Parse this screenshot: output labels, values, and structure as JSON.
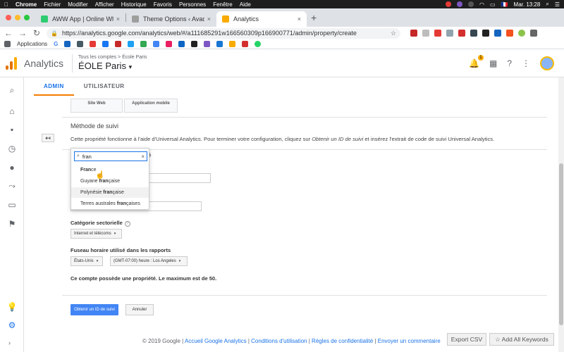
{
  "menubar": {
    "app": "Chrome",
    "items": [
      "Fichier",
      "Modifier",
      "Afficher",
      "Historique",
      "Favoris",
      "Personnes",
      "Fenêtre",
      "Aide"
    ],
    "flag": "🇫🇷",
    "clock": "Mar. 13:28"
  },
  "tabs": [
    {
      "title": "AWW App | Online Whiteboard",
      "close": "×",
      "color": "#2ecc71"
    },
    {
      "title": "Theme Options ‹ Avada Seo —",
      "close": "×",
      "color": "#9e9e9e"
    },
    {
      "title": "Analytics",
      "close": "×",
      "color": "#f9ab00"
    }
  ],
  "newtab_label": "+",
  "address": {
    "url": "https://analytics.google.com/analytics/web/#/a111685291w166560309p166900771/admin/property/create"
  },
  "bookmarks": {
    "apps_label": "Applications",
    "g_label": "G"
  },
  "ga": {
    "app_name": "Analytics",
    "breadcrumb": "Tous les comptes > École Paris",
    "property": "ÉOLE Paris",
    "property_caret": "▾",
    "notif_count": "1",
    "logo_colors": [
      "#f9ab00",
      "#e37400",
      "#e37400"
    ]
  },
  "admin_tabs": [
    "ADMIN",
    "UTILISATEUR"
  ],
  "form": {
    "segment_labels": [
      "Site Web",
      "Application mobile"
    ],
    "section_title": "Méthode de suivi",
    "desc_prefix": "Cette propriété fonctionne à l'aide d'Universal Analytics. Pour terminer votre configuration, cliquez sur ",
    "desc_link": "Obtenir un ID de suivi",
    "desc_suffix": " et insérez l'extrait de code de suivi Universal Analytics.",
    "partial_label": "é",
    "category_label": "Catégorie sectorielle",
    "category_help": "?",
    "category_value": "Internet et télécoms",
    "timezone_label": "Fuseau horaire utilisé dans les rapports",
    "country_value": "États-Unis",
    "timezone_value": "(GMT-07:00) heure : Los Angeles",
    "caret": "▾",
    "max_note": "Ce compte possède une propriété. Le maximum est de 50.",
    "primary_button": "Obtenir un ID de suivi",
    "cancel_button": "Annuler"
  },
  "dropdown": {
    "query": "fran",
    "clear": "×",
    "options": [
      {
        "before": "",
        "match": "Fran",
        "after": "ce"
      },
      {
        "before": "Guyane ",
        "match": "fran",
        "after": "çaise"
      },
      {
        "before": "Polynésie ",
        "match": "fran",
        "after": "çaise"
      },
      {
        "before": "Terres australes ",
        "match": "fran",
        "after": "çaises"
      }
    ]
  },
  "footer": {
    "copyright": "© 2019 Google | ",
    "links": [
      "Accueil Google Analytics",
      "Conditions d'utilisation",
      "Règles de confidentialité",
      "Envoyer un commentaire"
    ],
    "sep": " | "
  },
  "floating_buttons": {
    "export_csv": "Export CSV",
    "add_keywords": "☆ Add All Keywords"
  }
}
